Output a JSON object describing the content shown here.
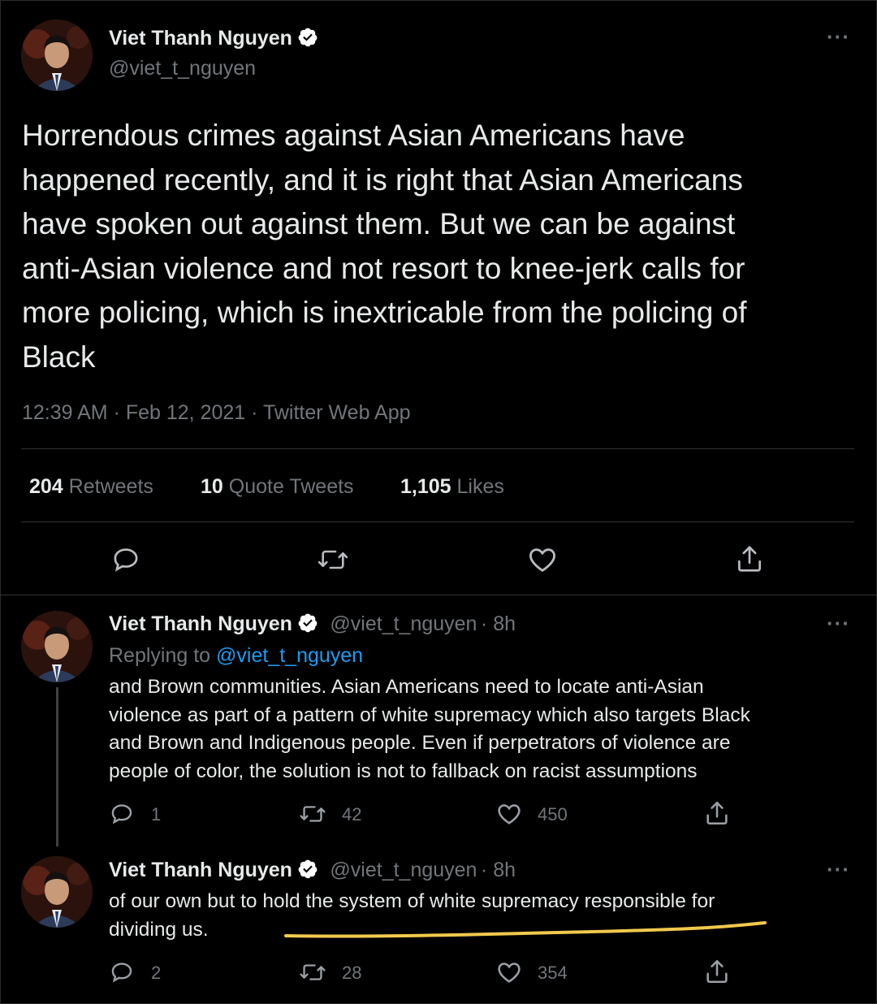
{
  "main_tweet": {
    "author_name": "Viet Thanh Nguyen",
    "author_handle": "@viet_t_nguyen",
    "text_lines": [
      "Horrendous crimes against Asian Americans have",
      "happened recently, and it is right that Asian Americans",
      "have spoken out against them. But we can be against",
      "anti-Asian violence and not resort to knee-jerk calls for",
      "more policing, which is inextricable from the policing of",
      "Black"
    ],
    "timestamp": "12:39 AM · Feb 12, 2021 · Twitter Web App",
    "stats": {
      "retweets_num": "204",
      "retweets_label": "Retweets",
      "quotes_num": "10",
      "quotes_label": "Quote Tweets",
      "likes_num": "1,105",
      "likes_label": "Likes"
    },
    "more_icon": "more-dots-icon"
  },
  "replies": [
    {
      "author_name": "Viet Thanh Nguyen",
      "author_handle": "@viet_t_nguyen",
      "time": "· 8h",
      "replying_prefix": "Replying to",
      "replying_to": "@viet_t_nguyen",
      "text_lines": [
        "and Brown communities. Asian Americans need to locate anti-Asian",
        "violence as part of a pattern of white supremacy which also targets Black",
        "and Brown and Indigenous people. Even if perpetrators of violence are",
        "people of color, the solution is not to fallback on racist assumptions"
      ],
      "reply_count": "1",
      "retweet_count": "42",
      "like_count": "450"
    },
    {
      "author_name": "Viet Thanh Nguyen",
      "author_handle": "@viet_t_nguyen",
      "time": "· 8h",
      "text_lines": [
        "of our own but to hold the system of white supremacy responsible for",
        "dividing us."
      ],
      "reply_count": "2",
      "retweet_count": "28",
      "like_count": "354"
    }
  ],
  "colors": {
    "background": "#000000",
    "text": "#e7e9ea",
    "muted": "#71767b",
    "link": "#1d9bf0",
    "verified": "#ffffff",
    "highlight_underline": "#f2c94c"
  }
}
